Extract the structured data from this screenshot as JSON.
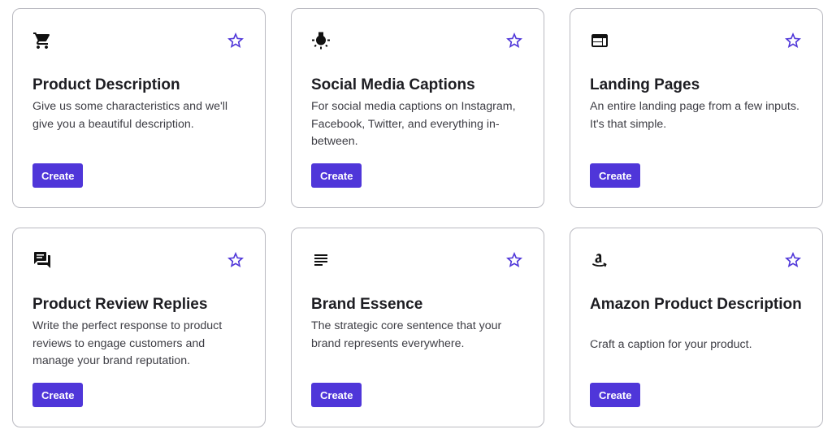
{
  "colors": {
    "accent": "#4f36d9",
    "border": "#b9b9c0",
    "star": "#4f36d9"
  },
  "cards": [
    {
      "icon": "shopping-cart-icon",
      "title": "Product Description",
      "description": "Give us some characteristics and we'll give you a beautiful description.",
      "button_label": "Create"
    },
    {
      "icon": "lightbulb-icon",
      "title": "Social Media Captions",
      "description": "For social media captions on Instagram, Facebook, Twitter, and everything in-between.",
      "button_label": "Create"
    },
    {
      "icon": "web-page-icon",
      "title": "Landing Pages",
      "description": "An entire landing page from a few inputs. It's that simple.",
      "button_label": "Create"
    },
    {
      "icon": "chat-bubbles-icon",
      "title": "Product Review Replies",
      "description": "Write the perfect response to product reviews to engage customers and manage your brand reputation.",
      "button_label": "Create"
    },
    {
      "icon": "text-lines-icon",
      "title": "Brand Essence",
      "description": "The strategic core sentence that your brand represents everywhere.",
      "button_label": "Create"
    },
    {
      "icon": "amazon-logo-icon",
      "title": "Amazon Product Description",
      "description": "Craft a caption for your product.",
      "button_label": "Create"
    }
  ]
}
